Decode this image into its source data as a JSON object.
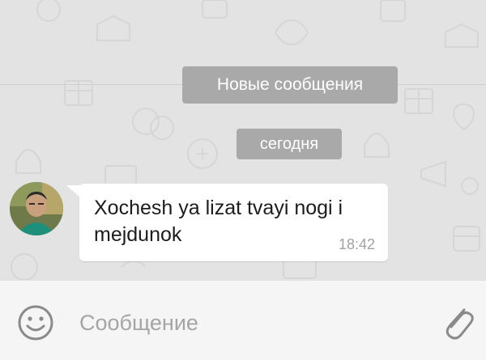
{
  "chat": {
    "new_messages_label": "Новые сообщения",
    "date_label": "сегодня"
  },
  "message": {
    "text": "Xochesh ya lizat tvayi nogi i mejdunok",
    "time": "18:42"
  },
  "composer": {
    "placeholder": "Сообщение"
  },
  "icons": {
    "emoji": "smiley-icon",
    "attach": "paperclip-icon"
  },
  "colors": {
    "pill_bg": "#a9a9a9",
    "chat_bg": "#e3e3e3",
    "bubble_bg": "#ffffff",
    "time_color": "#a2a2a2"
  }
}
